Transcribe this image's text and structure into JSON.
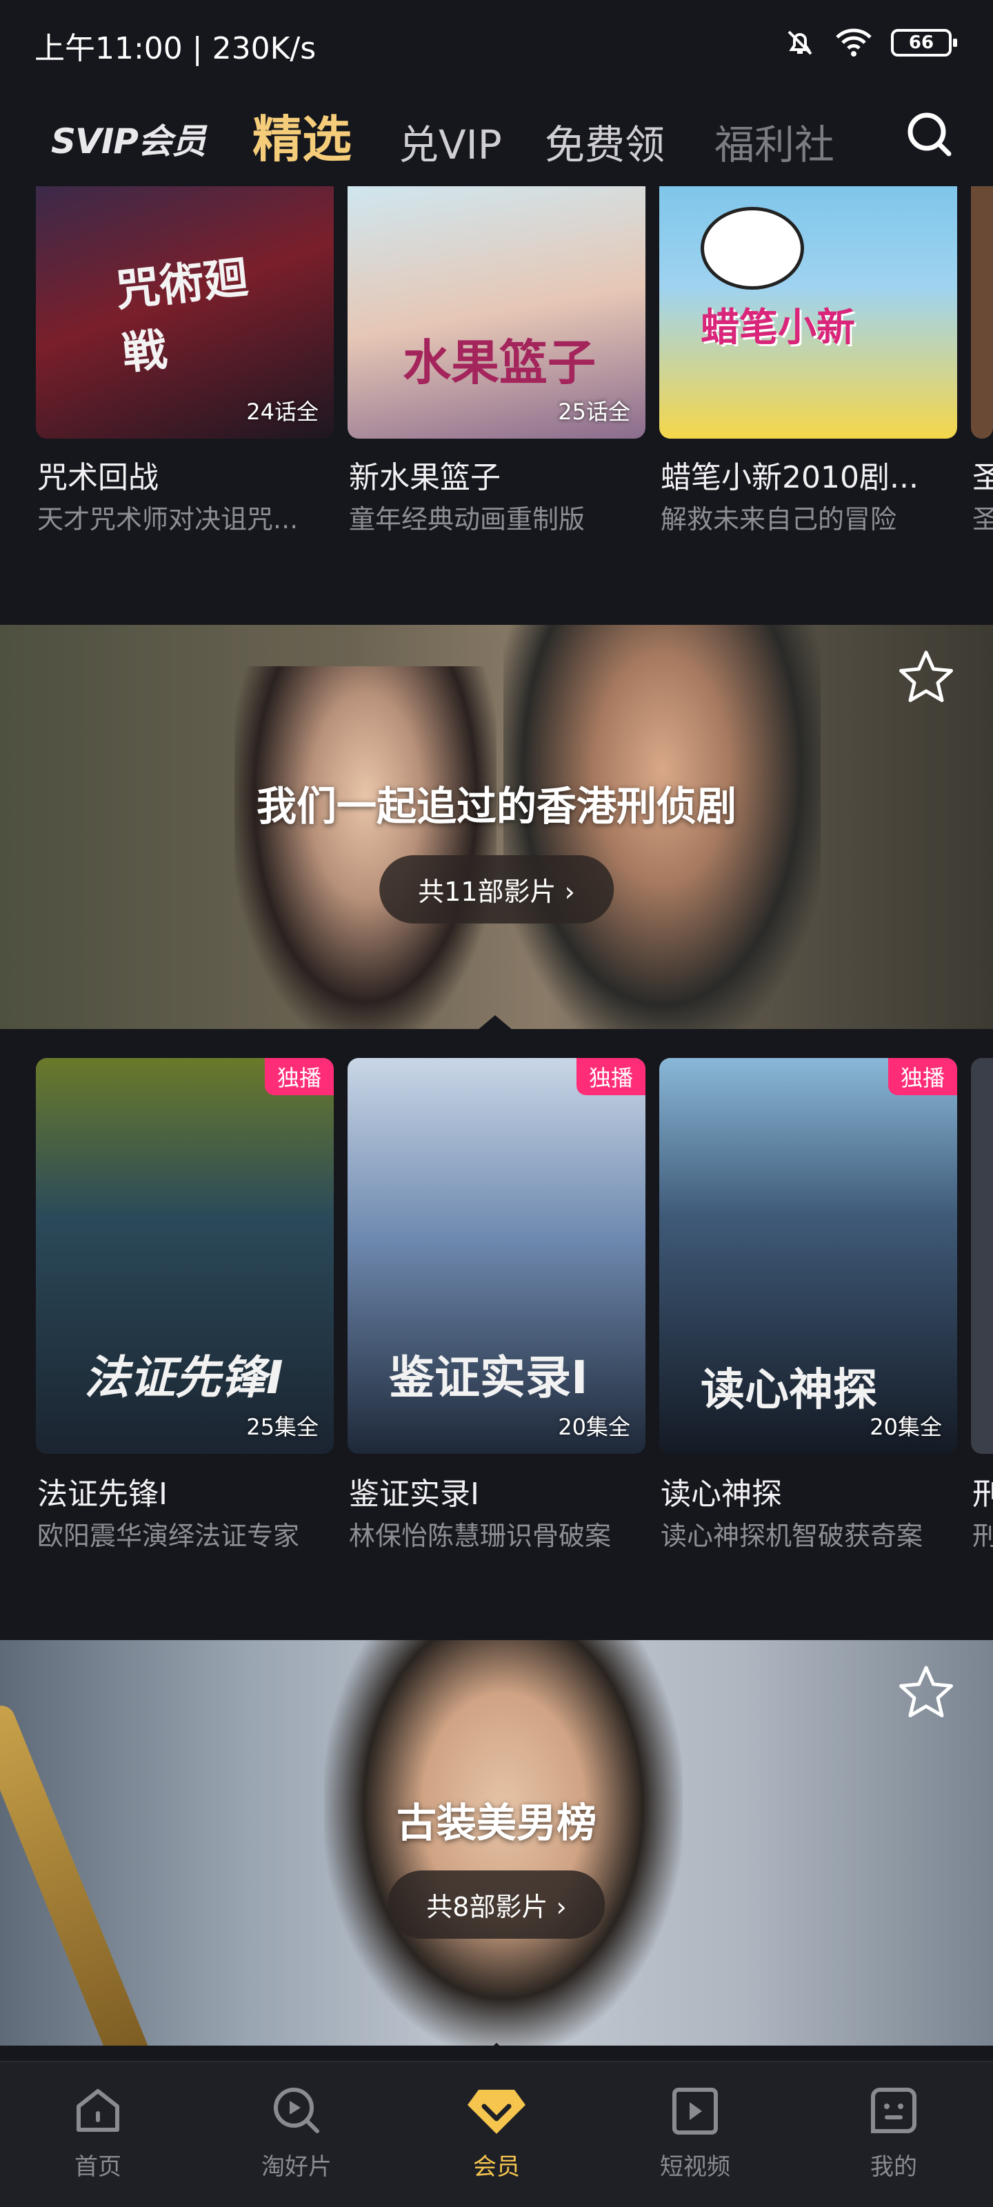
{
  "status_bar": {
    "time": "上午11:00 | 230K/s",
    "battery": "66"
  },
  "top_nav": {
    "brand": "SVIP会员",
    "tabs": [
      {
        "label": "精选",
        "active": true
      },
      {
        "label": "兑VIP",
        "active": false
      },
      {
        "label": "免费领",
        "active": false
      },
      {
        "label": "福利社",
        "active": false
      }
    ]
  },
  "row1": [
    {
      "title": "咒术回战",
      "subtitle": "天才咒术师对决诅咒...",
      "episodes": "24话全"
    },
    {
      "title": "新水果篮子",
      "subtitle": "童年经典动画重制版",
      "episodes": "25话全"
    },
    {
      "title": "蜡笔小新2010剧...",
      "subtitle": "解救未来自己的冒险",
      "episodes": ""
    },
    {
      "title": "圣",
      "subtitle": "圣",
      "episodes": ""
    }
  ],
  "banner1": {
    "title": "我们一起追过的香港刑侦剧",
    "count": "共11部影片 ›"
  },
  "row2": [
    {
      "title": "法证先锋I",
      "subtitle": "欧阳震华演绎法证专家",
      "episodes": "25集全",
      "badge": "独播"
    },
    {
      "title": "鉴证实录I",
      "subtitle": "林保怡陈慧珊识骨破案",
      "episodes": "20集全",
      "badge": "独播"
    },
    {
      "title": "读心神探",
      "subtitle": "读心神探机智破获奇案",
      "episodes": "20集全",
      "badge": "独播"
    },
    {
      "title": "刑",
      "subtitle": "刑",
      "episodes": "",
      "badge": ""
    }
  ],
  "banner2": {
    "title": "古装美男榜",
    "count": "共8部影片 ›"
  },
  "bottom_nav": [
    {
      "label": "首页",
      "icon": "home-icon"
    },
    {
      "label": "淘好片",
      "icon": "discover-icon"
    },
    {
      "label": "会员",
      "icon": "vip-diamond-icon",
      "active": true
    },
    {
      "label": "短视频",
      "icon": "short-video-icon"
    },
    {
      "label": "我的",
      "icon": "profile-icon"
    }
  ],
  "colors": {
    "accent": "#f5c54e",
    "badge": "#ff2d77",
    "background": "#16171c"
  }
}
